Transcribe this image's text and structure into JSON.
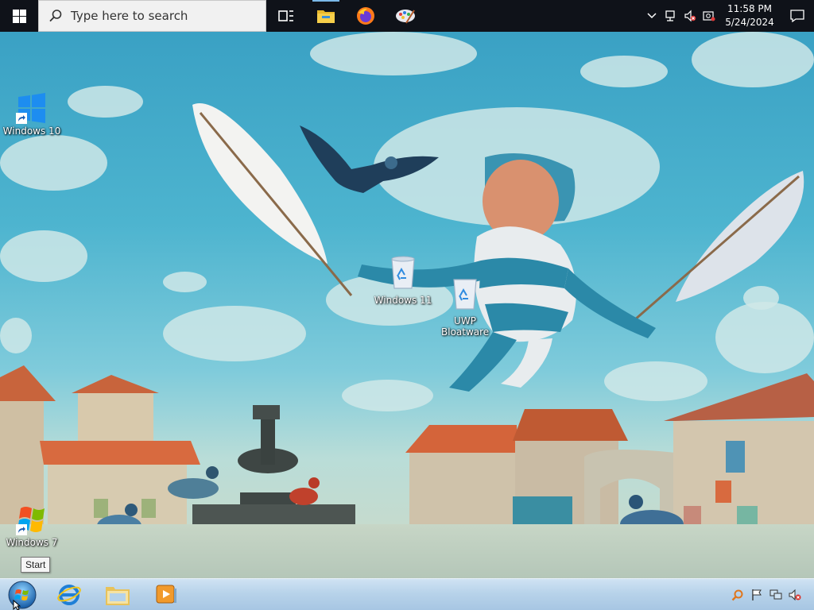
{
  "taskbar_top": {
    "search_placeholder": "Type here to search",
    "clock": {
      "time": "11:58 PM",
      "date": "5/24/2024"
    },
    "pinned": [
      "task-view-icon",
      "file-explorer-icon",
      "firefox-icon",
      "paint-icon"
    ],
    "tray_icons": [
      "chevron-up-icon",
      "network-icon",
      "volume-muted-icon",
      "battery-icon"
    ]
  },
  "desktop": {
    "icons": [
      {
        "label": "Windows 10",
        "icon": "windows-10-logo-icon"
      },
      {
        "label": "Windows 11",
        "icon": "recycle-bin-icon"
      },
      {
        "label": "UWP Bloatware",
        "icon": "recycle-bin-icon"
      },
      {
        "label": "Windows 7",
        "icon": "windows-7-logo-icon"
      }
    ]
  },
  "tooltip": {
    "text": "Start"
  },
  "taskbar_bottom": {
    "pinned": [
      "internet-explorer-icon",
      "windows-explorer-icon",
      "media-player-icon"
    ],
    "tray_icons": [
      "search-icon",
      "flag-icon",
      "network-icon",
      "volume-muted-icon"
    ]
  },
  "colors": {
    "taskbar_top": "#0f1219",
    "taskbar_bottom": "#b8d3ea",
    "accent": "#7ab8e8"
  }
}
